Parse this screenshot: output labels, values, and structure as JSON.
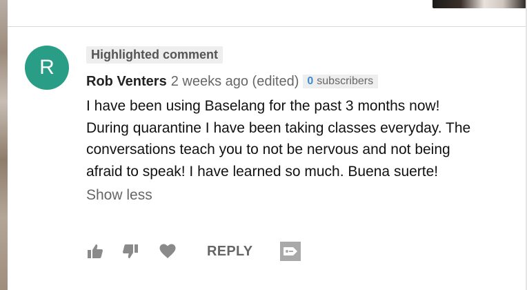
{
  "comment": {
    "highlight_label": "Highlighted comment",
    "avatar_letter": "R",
    "author": "Rob Venters",
    "time": "2 weeks ago (edited)",
    "subscriber_count": "0",
    "subscriber_label": "subscribers",
    "text": "I have been using Baselang for the past 3 months now! During quarantine I have been taking classes everyday. The conversations teach you to not be nervous and not being afraid to speak! I have learned so much. Buena suerte!",
    "show_less_label": "Show less"
  },
  "actions": {
    "like_icon": "thumbs-up-icon",
    "dislike_icon": "thumbs-down-icon",
    "heart_icon": "heart-icon",
    "reply_label": "REPLY",
    "share_icon": "share-icon"
  },
  "colors": {
    "avatar": "#2a9d86",
    "subscriber_count": "#3d8bd6",
    "icon_gray": "#8a8a8a"
  }
}
